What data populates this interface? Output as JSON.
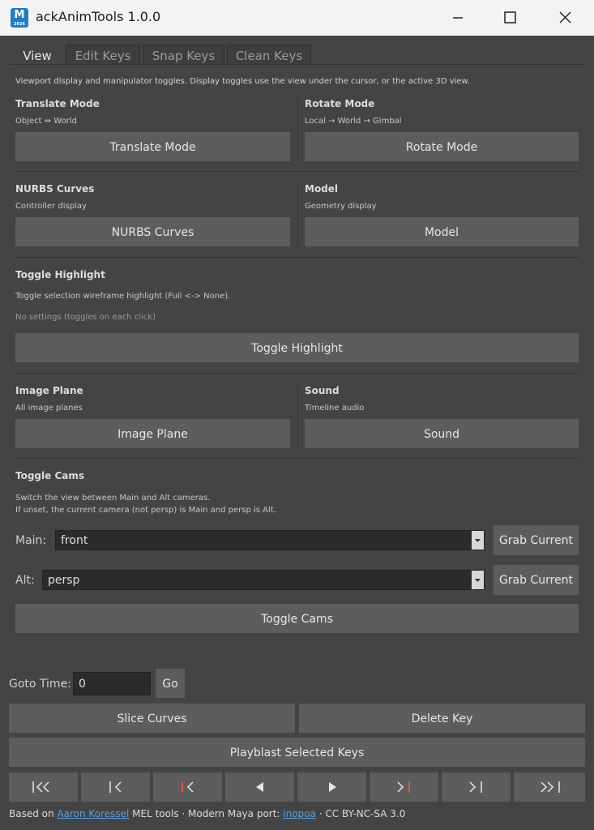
{
  "window": {
    "icon_letter": "M",
    "icon_sub": "2026",
    "title": "ackAnimTools 1.0.0"
  },
  "tabs": [
    "View",
    "Edit Keys",
    "Snap Keys",
    "Clean Keys"
  ],
  "description": "Viewport display and manipulator toggles. Display toggles use the view under the cursor, or the active 3D view.",
  "translate": {
    "title": "Translate Mode",
    "sub": "Object ⇔ World",
    "button": "Translate Mode"
  },
  "rotate": {
    "title": "Rotate Mode",
    "sub": "Local → World → Gimbal",
    "button": "Rotate Mode"
  },
  "nurbs": {
    "title": "NURBS Curves",
    "sub": "Controller display",
    "button": "NURBS Curves"
  },
  "model": {
    "title": "Model",
    "sub": "Geometry display",
    "button": "Model"
  },
  "highlight": {
    "title": "Toggle Highlight",
    "sub": "Toggle selection wireframe highlight (Full <-> None).",
    "note": "No settings (toggles on each click)",
    "button": "Toggle Highlight"
  },
  "image_plane": {
    "title": "Image Plane",
    "sub": "All image planes",
    "button": "Image Plane"
  },
  "sound": {
    "title": "Sound",
    "sub": "Timeline audio",
    "button": "Sound"
  },
  "cams": {
    "title": "Toggle Cams",
    "line1": "Switch the view between Main and Alt cameras.",
    "line2": "If unset, the current camera (not persp) is Main and persp is Alt.",
    "main_label": "Main:",
    "main_value": "front",
    "alt_label": "Alt:",
    "alt_value": "persp",
    "grab_label": "Grab Current",
    "button": "Toggle Cams"
  },
  "goto": {
    "label": "Goto Time:",
    "value": "0",
    "button": "Go"
  },
  "actions": {
    "slice": "Slice Curves",
    "delete": "Delete Key",
    "playblast": "Playblast Selected Keys"
  },
  "transport": [
    {
      "label": "|<<",
      "icon": "first-key-icon"
    },
    {
      "label": "|<",
      "icon": "prev-key-icon"
    },
    {
      "label": "|<",
      "icon": "prev-frame-icon",
      "accent": true
    },
    {
      "label": "◀",
      "icon": "step-back-icon"
    },
    {
      "label": "▶",
      "icon": "step-forward-icon"
    },
    {
      "label": ">|",
      "icon": "next-frame-icon",
      "accent": true
    },
    {
      "label": ">|",
      "icon": "next-key-icon"
    },
    {
      "label": ">>|",
      "icon": "last-key-icon"
    }
  ],
  "footer": {
    "prefix": "Based on",
    "link1": "Aaron Koressel",
    "mid1": "MEL tools  ·  Modern Maya port:",
    "link2": "inopoa",
    "suffix": "·  CC BY-NC-SA 3.0"
  },
  "colors": {
    "accent": "#e0563a",
    "link": "#5aa0e0",
    "button": "#5d5d5d",
    "panel": "#444444"
  }
}
